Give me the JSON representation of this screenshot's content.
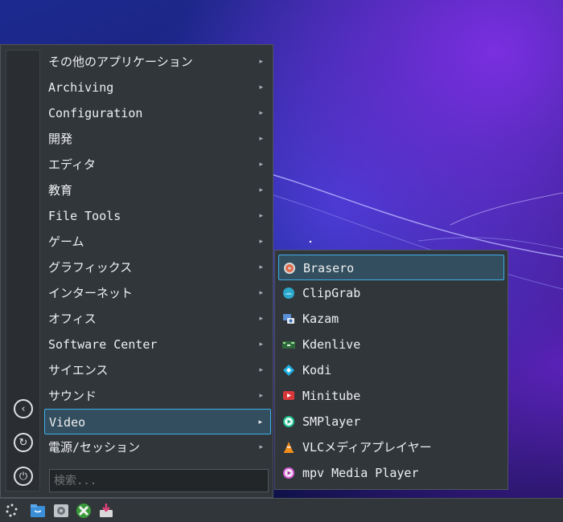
{
  "menu": {
    "items": [
      {
        "label": "その他のアプリケーション",
        "arrow": "▸"
      },
      {
        "label": "Archiving",
        "arrow": "▸"
      },
      {
        "label": "Configuration",
        "arrow": "▸"
      },
      {
        "label": "開発",
        "arrow": "▸"
      },
      {
        "label": "エディタ",
        "arrow": "▸"
      },
      {
        "label": "教育",
        "arrow": "▸"
      },
      {
        "label": "File Tools",
        "arrow": "▸"
      },
      {
        "label": "ゲーム",
        "arrow": "▸"
      },
      {
        "label": "グラフィックス",
        "arrow": "▸"
      },
      {
        "label": "インターネット",
        "arrow": "▸"
      },
      {
        "label": "オフィス",
        "arrow": "▸"
      },
      {
        "label": "Software Center",
        "arrow": "▸"
      },
      {
        "label": "サイエンス",
        "arrow": "▸"
      },
      {
        "label": "サウンド",
        "arrow": "▸"
      },
      {
        "label": "Video",
        "arrow": "▸",
        "selected": true
      },
      {
        "label": "電源/セッション",
        "arrow": "▸"
      }
    ],
    "search_placeholder": "検索..."
  },
  "submenu": {
    "items": [
      {
        "label": "Brasero",
        "icon": "brasero-icon",
        "selected": true
      },
      {
        "label": "ClipGrab",
        "icon": "clipgrab-icon"
      },
      {
        "label": "Kazam",
        "icon": "kazam-icon"
      },
      {
        "label": "Kdenlive",
        "icon": "kdenlive-icon"
      },
      {
        "label": "Kodi",
        "icon": "kodi-icon"
      },
      {
        "label": "Minitube",
        "icon": "minitube-icon"
      },
      {
        "label": "SMPlayer",
        "icon": "smplayer-icon"
      },
      {
        "label": "VLCメディアプレイヤー",
        "icon": "vlc-icon"
      },
      {
        "label": "mpv Media Player",
        "icon": "mpv-icon"
      }
    ]
  },
  "side_buttons": [
    "back-icon",
    "refresh-icon",
    "power-icon"
  ],
  "taskbar": {
    "icons": [
      "app-menu-icon",
      "file-manager-icon",
      "settings-icon",
      "xarchiver-icon",
      "download-icon"
    ]
  },
  "colors": {
    "panel_bg": "#31363b",
    "highlight_border": "#3daee9",
    "highlight_bg": "#334e5e",
    "text": "#eff0f1"
  }
}
